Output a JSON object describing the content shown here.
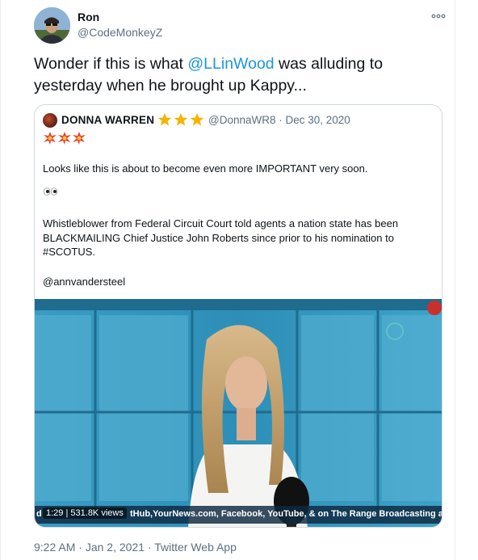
{
  "tweet": {
    "author_name": "Ron",
    "author_handle": "@CodeMonkeyZ",
    "text_before": "Wonder if this is what ",
    "mention": "@LLinWood",
    "text_after": " was alluding to yesterday when he brought up Kappy...",
    "time": "9:22 AM",
    "date": "Jan 2, 2021",
    "source": "Twitter Web App",
    "sep": " · "
  },
  "quote": {
    "author_name": "DONNA WARREN",
    "stars": "⭐⭐⭐",
    "author_handle": "@DonnaWR8",
    "date": "Dec 30, 2020",
    "meta_sep": " · ",
    "emoji_row": "💥💥💥",
    "para1": "Looks like this is about to become even more IMPORTANT very soon.",
    "eyes": "👀",
    "para2": "Whistleblower from Federal Circuit Court told agents a nation state has been BLACKMAILING Chief Justice John Roberts since prior to his nomination to #SCOTUS.",
    "para3": "@annvandersteel",
    "video": {
      "duration": "1:29",
      "views": "531.8K views",
      "ticker_prefix": "d",
      "ticker": "tHub,YourNews.com, Facebook, YouTube, & on The Range Broadcasting a"
    }
  }
}
